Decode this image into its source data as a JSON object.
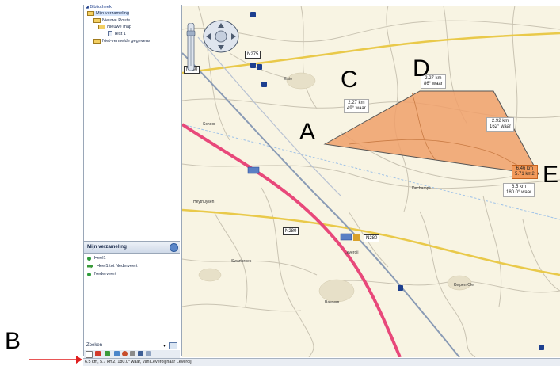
{
  "library": {
    "title": "Bibliotheek",
    "items": [
      {
        "label": "Mijn verzameling"
      },
      {
        "label": "Nieuwe Route"
      },
      {
        "label": "Nieuwe map"
      },
      {
        "label": "Test 1"
      },
      {
        "label": "Niet-vermelde gegevens"
      }
    ]
  },
  "collection": {
    "title": "Mijn verzameling",
    "items": [
      {
        "label": "Heel1",
        "icon": "green-dot-icon"
      },
      {
        "label": "Heel1 tot Nederveert",
        "icon": "route-arrow-icon"
      },
      {
        "label": "Nederveert",
        "icon": "green-dot-icon"
      }
    ]
  },
  "search": {
    "label": "Zoeken"
  },
  "status": {
    "text": "6.5 km, 5.7 km2, 180.0° waar, van Leveroij naar Leveroij"
  },
  "annotations": {
    "A": "A",
    "B": "B",
    "C": "C",
    "D": "D",
    "E": "E"
  },
  "map": {
    "shields": [
      "N275",
      "N280",
      "N280",
      "N280"
    ],
    "place_labels": [
      "Eiste",
      "Schoor",
      "Heythuysen",
      "Swartbroek",
      "Leveroij",
      "Kelpen-Oler",
      "Dechamps",
      "Baexem"
    ],
    "measurements": [
      {
        "line1": "2.27 km",
        "line2": "49° waar"
      },
      {
        "line1": "2.27 km",
        "line2": "86° waar"
      },
      {
        "line1": "2.92 km",
        "line2": "162° waar"
      },
      {
        "line1": "6.46 km",
        "line2": "5.71 km2"
      },
      {
        "line1": "6.5 km",
        "line2": "180.0° waar"
      }
    ],
    "area_color": "#f0a06a",
    "motorway_color": "#e8487a"
  }
}
